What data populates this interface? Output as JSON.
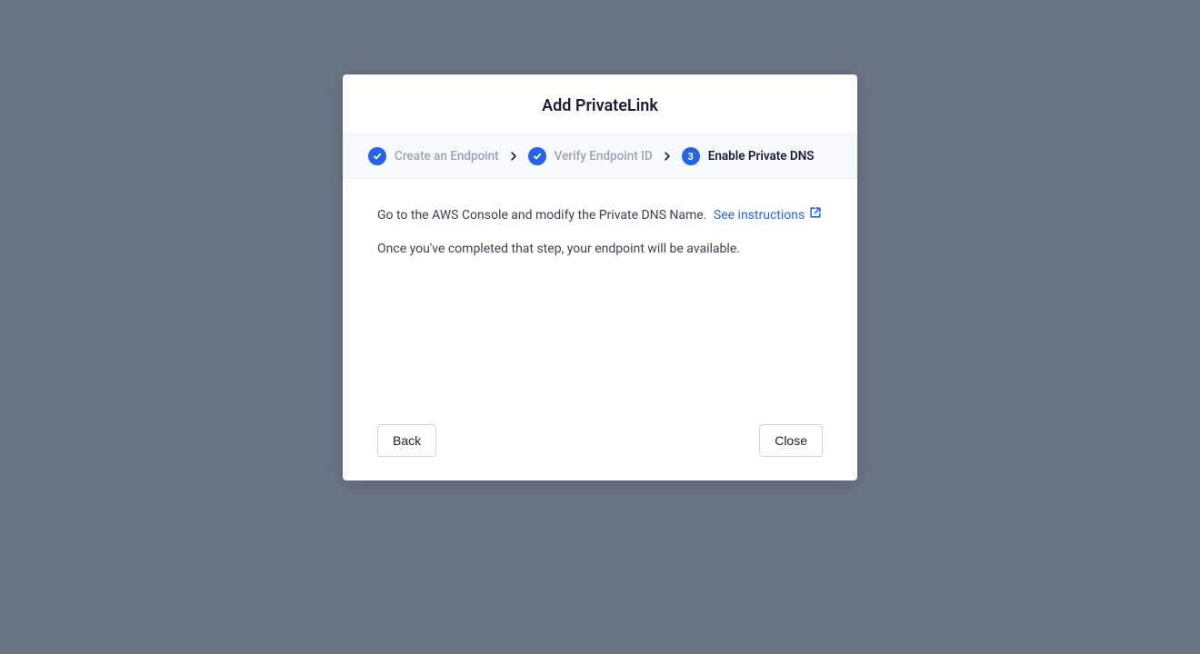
{
  "modal": {
    "title": "Add PrivateLink",
    "stepper": {
      "steps": [
        {
          "label": "Create an Endpoint",
          "state": "done"
        },
        {
          "label": "Verify Endpoint ID",
          "state": "done"
        },
        {
          "label": "Enable Private DNS",
          "state": "active",
          "number": "3"
        }
      ]
    },
    "body": {
      "line1": "Go to the AWS Console and modify the Private DNS Name.",
      "link_text": "See instructions",
      "line2": "Once you've completed that step, your endpoint will be available."
    },
    "footer": {
      "back_label": "Back",
      "close_label": "Close"
    }
  },
  "colors": {
    "accent": "#2563eb",
    "muted_text": "#9aa3b2",
    "body_text": "#3b4150",
    "heading": "#1a1f36",
    "backdrop": "#6b7484",
    "stepper_bg": "#f7f9fc"
  }
}
